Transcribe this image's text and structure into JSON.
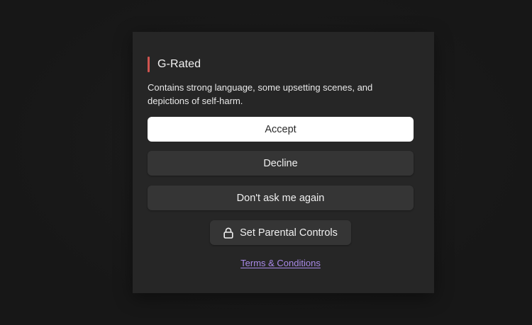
{
  "dialog": {
    "title": "G-Rated",
    "description": "Contains strong language, some upsetting scenes, and depictions of self-harm.",
    "accept_label": "Accept",
    "decline_label": "Decline",
    "dont_ask_label": "Don't ask me again",
    "parental_label": "Set Parental Controls",
    "parental_icon": "lock-icon",
    "terms_label": "Terms & Conditions",
    "accent_color": "#d0544f",
    "link_color": "#a98ae8"
  }
}
